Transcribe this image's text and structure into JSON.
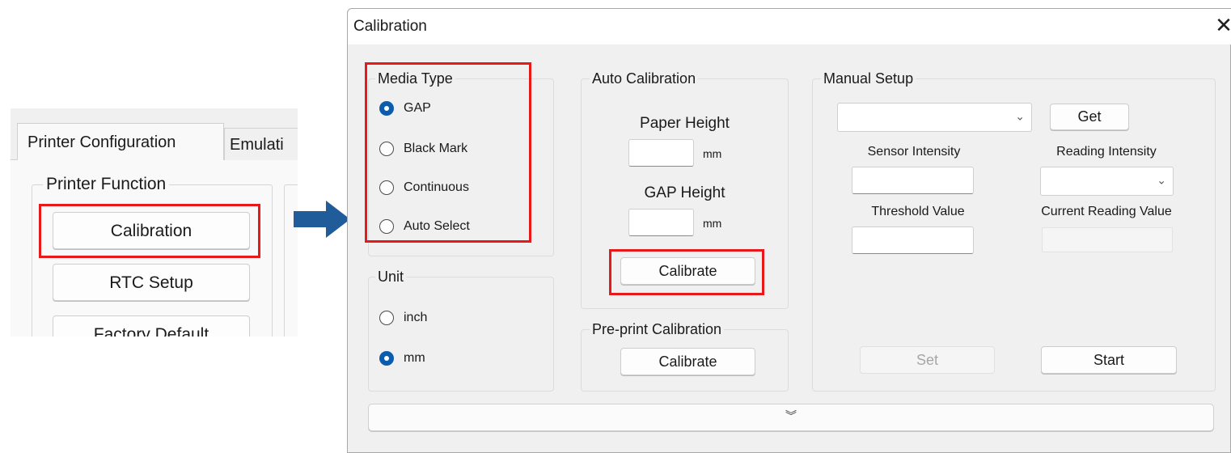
{
  "left_panel": {
    "tabs": [
      "Printer Configuration",
      "Emulati"
    ],
    "group_title": "Printer Function",
    "buttons": [
      "Calibration",
      "RTC Setup",
      "Factory Default"
    ]
  },
  "dialog": {
    "title": "Calibration",
    "close_glyph": "✕",
    "media_type": {
      "title": "Media Type",
      "options": [
        "GAP",
        "Black Mark",
        "Continuous",
        "Auto Select"
      ],
      "selected": "GAP"
    },
    "unit": {
      "title": "Unit",
      "options": [
        "inch",
        "mm"
      ],
      "selected": "mm"
    },
    "auto_calibration": {
      "title": "Auto Calibration",
      "paper_height_label": "Paper Height",
      "paper_height_value": "",
      "paper_height_unit": "mm",
      "gap_height_label": "GAP Height",
      "gap_height_value": "",
      "gap_height_unit": "mm",
      "calibrate_label": "Calibrate"
    },
    "preprint_calibration": {
      "title": "Pre-print Calibration",
      "calibrate_label": "Calibrate"
    },
    "manual_setup": {
      "title": "Manual Setup",
      "combo_value": "",
      "get_label": "Get",
      "sensor_intensity_label": "Sensor Intensity",
      "sensor_intensity_value": "",
      "reading_intensity_label": "Reading Intensity",
      "reading_intensity_value": "",
      "threshold_label": "Threshold Value",
      "threshold_value": "",
      "current_reading_label": "Current Reading Value",
      "current_reading_value": "",
      "set_label": "Set",
      "start_label": "Start"
    },
    "expander_glyph": "︾"
  },
  "colors": {
    "highlight_red": "#e8191b",
    "arrow_blue": "#1f5c99",
    "radio_selected": "#0b5cad"
  }
}
